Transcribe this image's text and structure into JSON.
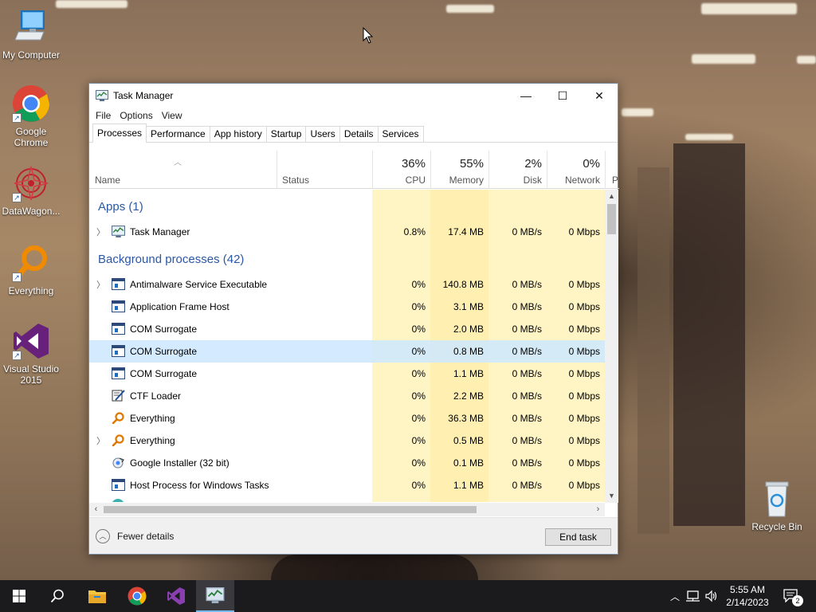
{
  "desktop": {
    "icons": [
      {
        "label": "My Computer",
        "icon": "computer-icon"
      },
      {
        "label": "Google Chrome",
        "icon": "chrome-icon"
      },
      {
        "label": "DataWagon...",
        "icon": "datawagon-icon"
      },
      {
        "label": "Everything",
        "icon": "everything-icon"
      },
      {
        "label": "Visual Studio 2015",
        "icon": "visual-studio-icon"
      },
      {
        "label": "Recycle Bin",
        "icon": "recycle-bin-icon"
      }
    ]
  },
  "window": {
    "title": "Task Manager",
    "controls": {
      "minimize": "—",
      "maximize": "☐",
      "close": "✕"
    }
  },
  "menu": [
    "File",
    "Options",
    "View"
  ],
  "tabs": [
    "Processes",
    "Performance",
    "App history",
    "Startup",
    "Users",
    "Details",
    "Services"
  ],
  "active_tab": "Processes",
  "columns": {
    "name": "Name",
    "status": "Status",
    "cpu": {
      "pct": "36%",
      "label": "CPU"
    },
    "memory": {
      "pct": "55%",
      "label": "Memory"
    },
    "disk": {
      "pct": "2%",
      "label": "Disk"
    },
    "network": {
      "pct": "0%",
      "label": "Network"
    },
    "power": "P"
  },
  "groups": {
    "apps": "Apps (1)",
    "background": "Background processes (42)"
  },
  "rows": [
    {
      "name": "Task Manager",
      "cpu": "0.8%",
      "mem": "17.4 MB",
      "disk": "0 MB/s",
      "net": "0 Mbps",
      "icon": "task-manager-icon",
      "expand": true
    },
    {
      "name": "Antimalware Service Executable",
      "cpu": "0%",
      "mem": "140.8 MB",
      "disk": "0 MB/s",
      "net": "0 Mbps",
      "icon": "process-icon",
      "expand": true
    },
    {
      "name": "Application Frame Host",
      "cpu": "0%",
      "mem": "3.1 MB",
      "disk": "0 MB/s",
      "net": "0 Mbps",
      "icon": "process-icon",
      "expand": false
    },
    {
      "name": "COM Surrogate",
      "cpu": "0%",
      "mem": "2.0 MB",
      "disk": "0 MB/s",
      "net": "0 Mbps",
      "icon": "process-icon",
      "expand": false
    },
    {
      "name": "COM Surrogate",
      "cpu": "0%",
      "mem": "0.8 MB",
      "disk": "0 MB/s",
      "net": "0 Mbps",
      "icon": "process-icon",
      "expand": false,
      "selected": true
    },
    {
      "name": "COM Surrogate",
      "cpu": "0%",
      "mem": "1.1 MB",
      "disk": "0 MB/s",
      "net": "0 Mbps",
      "icon": "process-icon",
      "expand": false
    },
    {
      "name": "CTF Loader",
      "cpu": "0%",
      "mem": "2.2 MB",
      "disk": "0 MB/s",
      "net": "0 Mbps",
      "icon": "ctf-loader-icon",
      "expand": false
    },
    {
      "name": "Everything",
      "cpu": "0%",
      "mem": "36.3 MB",
      "disk": "0 MB/s",
      "net": "0 Mbps",
      "icon": "everything-icon",
      "expand": false
    },
    {
      "name": "Everything",
      "cpu": "0%",
      "mem": "0.5 MB",
      "disk": "0 MB/s",
      "net": "0 Mbps",
      "icon": "everything-icon",
      "expand": true
    },
    {
      "name": "Google Installer (32 bit)",
      "cpu": "0%",
      "mem": "0.1 MB",
      "disk": "0 MB/s",
      "net": "0 Mbps",
      "icon": "google-installer-icon",
      "expand": false
    },
    {
      "name": "Host Process for Windows Tasks",
      "cpu": "0%",
      "mem": "1.1 MB",
      "disk": "0 MB/s",
      "net": "0 Mbps",
      "icon": "process-icon",
      "expand": false
    }
  ],
  "footer": {
    "fewer_details": "Fewer details",
    "end_task": "End task"
  },
  "taskbar": {
    "time": "5:55 AM",
    "date": "2/14/2023",
    "notifications": "2",
    "apps": [
      "start-icon",
      "search-icon",
      "file-explorer-icon",
      "chrome-icon",
      "visual-studio-icon",
      "task-manager-icon"
    ]
  },
  "colors": {
    "accent_blue": "#2b58a6",
    "heat_yellow": "#fff4c4",
    "selection": "#cce8ff",
    "taskbar": "#1b1b1e"
  }
}
